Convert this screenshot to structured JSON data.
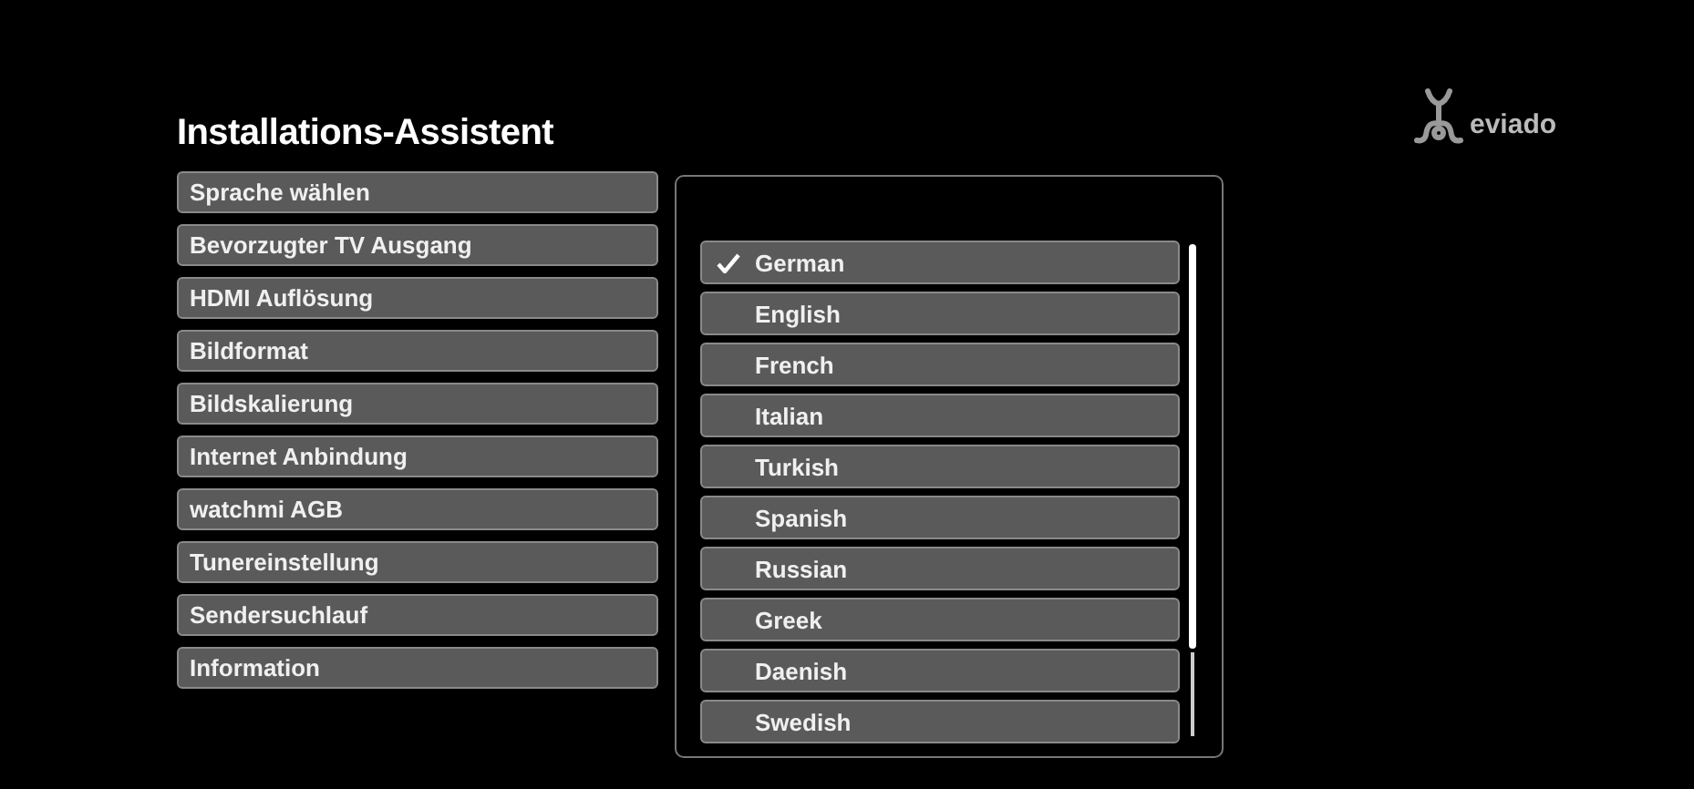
{
  "title": "Installations-Assistent",
  "logo": {
    "text": "eviado"
  },
  "menu": [
    {
      "label": "Sprache wählen"
    },
    {
      "label": "Bevorzugter TV Ausgang"
    },
    {
      "label": "HDMI Auflösung"
    },
    {
      "label": "Bildformat"
    },
    {
      "label": "Bildskalierung"
    },
    {
      "label": "Internet Anbindung"
    },
    {
      "label": "watchmi AGB"
    },
    {
      "label": "Tunereinstellung"
    },
    {
      "label": "Sendersuchlauf"
    },
    {
      "label": "Information"
    }
  ],
  "languages": [
    {
      "label": "German",
      "checked": true
    },
    {
      "label": "English",
      "checked": false
    },
    {
      "label": "French",
      "checked": false
    },
    {
      "label": "Italian",
      "checked": false
    },
    {
      "label": "Turkish",
      "checked": false
    },
    {
      "label": "Spanish",
      "checked": false
    },
    {
      "label": "Russian",
      "checked": false
    },
    {
      "label": "Greek",
      "checked": false
    },
    {
      "label": "Daenish",
      "checked": false
    },
    {
      "label": "Swedish",
      "checked": false
    }
  ]
}
